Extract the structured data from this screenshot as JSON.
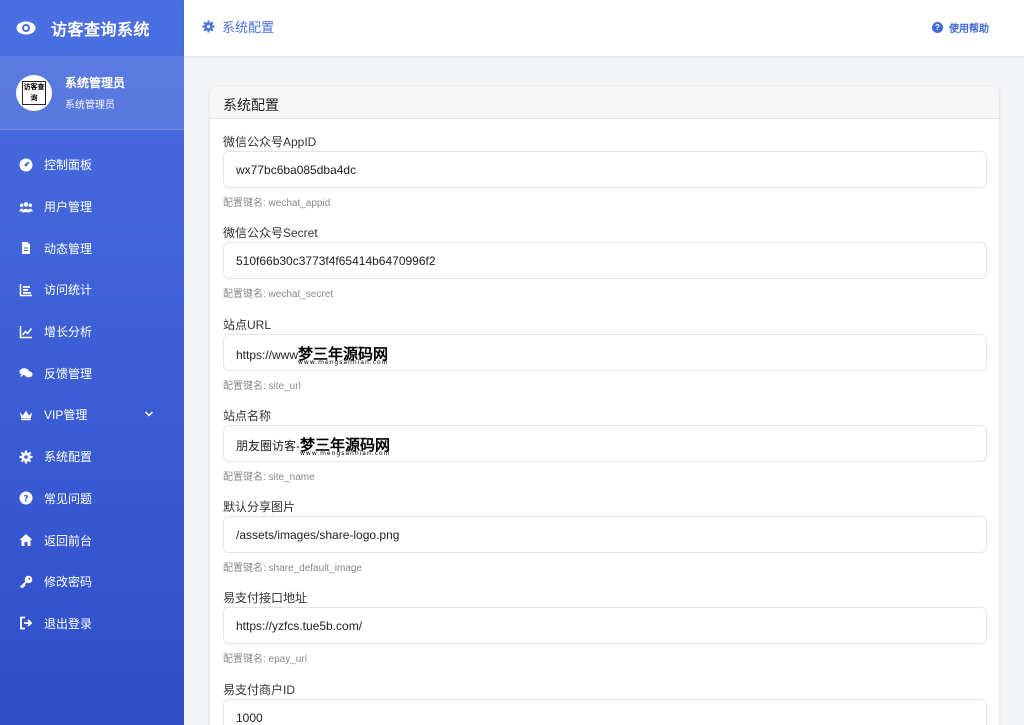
{
  "app": {
    "title": "访客查询系统"
  },
  "user": {
    "name": "系统管理员",
    "role": "系统管理员",
    "avatar_text": "访客查询"
  },
  "nav": [
    {
      "label": "控制面板",
      "icon": "dashboard-icon"
    },
    {
      "label": "用户管理",
      "icon": "users-icon"
    },
    {
      "label": "动态管理",
      "icon": "file-icon"
    },
    {
      "label": "访问统计",
      "icon": "bar-chart-icon"
    },
    {
      "label": "增长分析",
      "icon": "line-chart-icon"
    },
    {
      "label": "反馈管理",
      "icon": "comments-icon"
    },
    {
      "label": "VIP管理",
      "icon": "crown-icon"
    },
    {
      "label": "系统配置",
      "icon": "gear-icon"
    },
    {
      "label": "常见问题",
      "icon": "question-icon"
    },
    {
      "label": "返回前台",
      "icon": "home-icon"
    },
    {
      "label": "修改密码",
      "icon": "key-icon"
    },
    {
      "label": "退出登录",
      "icon": "logout-icon"
    }
  ],
  "header": {
    "breadcrumb": "系统配置",
    "help_label": "使用帮助"
  },
  "card": {
    "title": "系统配置"
  },
  "watermark": {
    "text": "梦三年源码网",
    "sub": "www.mengsannian.com"
  },
  "fields": [
    {
      "label": "微信公众号AppID",
      "value": "wx77bc6ba085dba4dc",
      "hint": "配置键名: wechat_appid"
    },
    {
      "label": "微信公众号Secret",
      "value": "510f66b30c3773f4f65414b6470996f2",
      "hint": "配置键名: wechat_secret"
    },
    {
      "label": "站点URL",
      "value": "https://www",
      "hint": "配置键名: site_url"
    },
    {
      "label": "站点名称",
      "value": "朋友圈访客-",
      "hint": "配置键名: site_name"
    },
    {
      "label": "默认分享图片",
      "value": "/assets/images/share-logo.png",
      "hint": "配置键名: share_default_image"
    },
    {
      "label": "易支付接口地址",
      "value": "https://yzfcs.tue5b.com/",
      "hint": "配置键名: epay_url"
    },
    {
      "label": "易支付商户ID",
      "value": "1000",
      "hint": ""
    }
  ],
  "colors": {
    "sidebar": "#4a6fe0",
    "accent": "#3f6ad8"
  }
}
